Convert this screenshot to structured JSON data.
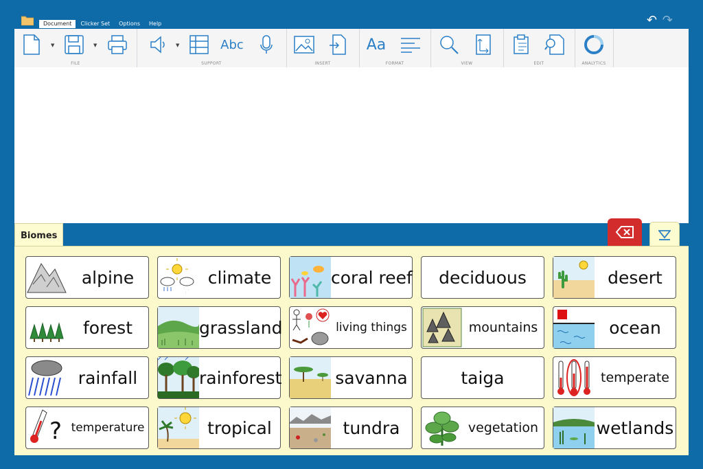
{
  "menu": {
    "tabs": [
      {
        "label": "Document"
      },
      {
        "label": "Clicker Set"
      },
      {
        "label": "Options"
      },
      {
        "label": "Help"
      }
    ],
    "undo_icon": "undo-icon",
    "redo_icon": "redo-icon"
  },
  "toolbar": {
    "groups": [
      {
        "label": "FILE"
      },
      {
        "label": "SUPPORT"
      },
      {
        "label": "INSERT"
      },
      {
        "label": "FORMAT"
      },
      {
        "label": "VIEW"
      },
      {
        "label": "EDIT"
      },
      {
        "label": "ANALYTICS"
      }
    ],
    "spell_label": "Abc",
    "format_label": "Aa"
  },
  "board": {
    "tab_label": "Biomes",
    "backspace_icon": "backspace-icon",
    "collapse_icon": "triangle-down-icon",
    "cells": [
      {
        "word": "alpine"
      },
      {
        "word": "climate"
      },
      {
        "word": "coral reef"
      },
      {
        "word": "deciduous"
      },
      {
        "word": "desert"
      },
      {
        "word": "forest"
      },
      {
        "word": "grassland"
      },
      {
        "word": "living things"
      },
      {
        "word": "mountains"
      },
      {
        "word": "ocean"
      },
      {
        "word": "rainfall"
      },
      {
        "word": "rainforest"
      },
      {
        "word": "savanna"
      },
      {
        "word": "taiga"
      },
      {
        "word": "temperate"
      },
      {
        "word": "temperature"
      },
      {
        "word": "tropical"
      },
      {
        "word": "tundra"
      },
      {
        "word": "vegetation"
      },
      {
        "word": "wetlands"
      }
    ]
  },
  "colors": {
    "frame": "#0f6aa8",
    "board_bg": "#fcf9cd",
    "backspace": "#d32c2c",
    "accent": "#2a7fc6"
  }
}
